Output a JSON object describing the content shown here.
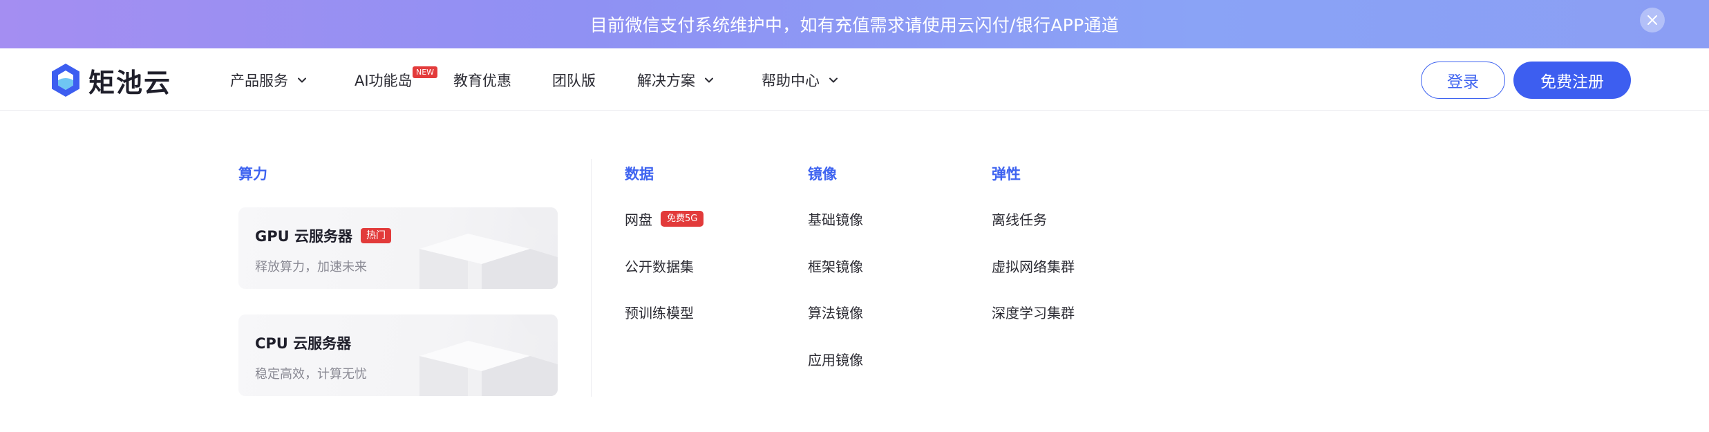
{
  "banner": {
    "text": "目前微信支付系统维护中，如有充值需求请使用云闪付/银行APP通道"
  },
  "brand": {
    "name": "矩池云",
    "accent": "#3d5ef0"
  },
  "nav": {
    "items": [
      {
        "label": "产品服务",
        "dropdown": true
      },
      {
        "label": "AI功能岛",
        "badge": "NEW"
      },
      {
        "label": "教育优惠"
      },
      {
        "label": "团队版"
      },
      {
        "label": "解决方案",
        "dropdown": true
      },
      {
        "label": "帮助中心",
        "dropdown": true
      }
    ],
    "login_label": "登录",
    "register_label": "免费注册"
  },
  "menu": {
    "compute": {
      "title": "算力",
      "cards": [
        {
          "title": "GPU 云服务器",
          "badge": "热门",
          "desc": "释放算力，加速未来"
        },
        {
          "title": "CPU 云服务器",
          "desc": "稳定高效，计算无忧"
        }
      ]
    },
    "data": {
      "title": "数据",
      "links": [
        {
          "label": "网盘",
          "badge": "免费5G"
        },
        {
          "label": "公开数据集"
        },
        {
          "label": "预训练模型"
        }
      ]
    },
    "image": {
      "title": "镜像",
      "links": [
        {
          "label": "基础镜像"
        },
        {
          "label": "框架镜像"
        },
        {
          "label": "算法镜像"
        },
        {
          "label": "应用镜像"
        }
      ]
    },
    "elastic": {
      "title": "弹性",
      "links": [
        {
          "label": "离线任务"
        },
        {
          "label": "虚拟网络集群"
        },
        {
          "label": "深度学习集群"
        }
      ]
    }
  },
  "colors": {
    "accent": "#3e63f0",
    "hot": "#e23a3a",
    "banner_start": "#a48ef2",
    "banner_end": "#8b9ef4"
  },
  "icons": {
    "banner_close": "close-icon",
    "dropdown": "chevron-down-icon",
    "logo": "hexagon-logo-icon"
  }
}
